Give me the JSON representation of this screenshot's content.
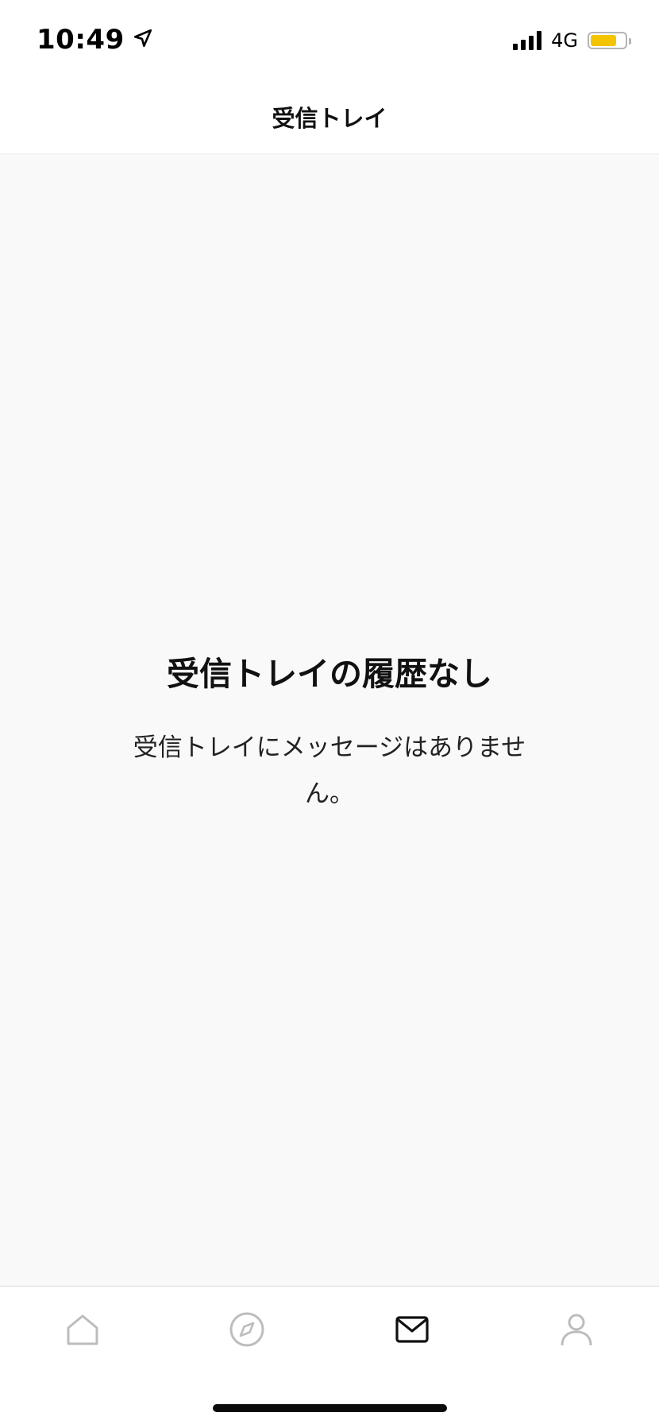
{
  "status_bar": {
    "time": "10:49",
    "network": "4G",
    "battery_level": 0.75,
    "battery_color": "#f4c400",
    "icons": [
      "location-arrow-icon",
      "signal-icon",
      "battery-icon"
    ]
  },
  "header": {
    "title": "受信トレイ"
  },
  "empty_state": {
    "title": "受信トレイの履歴なし",
    "description": "受信トレイにメッセージはありません。"
  },
  "tab_bar": {
    "items": [
      {
        "icon": "home-icon",
        "active": false
      },
      {
        "icon": "compass-icon",
        "active": false
      },
      {
        "icon": "mail-icon",
        "active": true
      },
      {
        "icon": "profile-icon",
        "active": false
      }
    ],
    "active_color": "#111111",
    "inactive_color": "#bdbdbd"
  }
}
